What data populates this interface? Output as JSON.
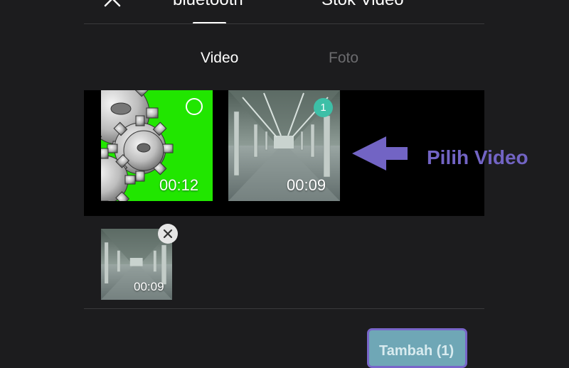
{
  "header": {
    "close_icon": "close-icon",
    "tabs": [
      {
        "label": "bluetooth"
      },
      {
        "label": "Stok Video"
      }
    ]
  },
  "media_tabs": [
    {
      "label": "Video",
      "active": true
    },
    {
      "label": "Foto",
      "active": false
    }
  ],
  "gallery": {
    "items": [
      {
        "duration": "00:12",
        "selected": false,
        "thumbnail": "green-gears"
      },
      {
        "duration": "00:09",
        "selected": true,
        "selection_number": "1",
        "thumbnail": "empty-hall"
      }
    ]
  },
  "annotation": {
    "text": "Pilih Video",
    "arrow_icon": "arrow-left-icon",
    "color": "#7264c4"
  },
  "selected_tray": {
    "items": [
      {
        "duration": "00:09",
        "remove_icon": "close-icon"
      }
    ]
  },
  "footer": {
    "add_label": "Tambah (1)"
  },
  "colors": {
    "background": "#1c1c1e",
    "selection_badge": "#3dbfa7",
    "green_screen": "#21e600",
    "button_border": "#7866c9",
    "button_fill": "#6fa7b6"
  }
}
